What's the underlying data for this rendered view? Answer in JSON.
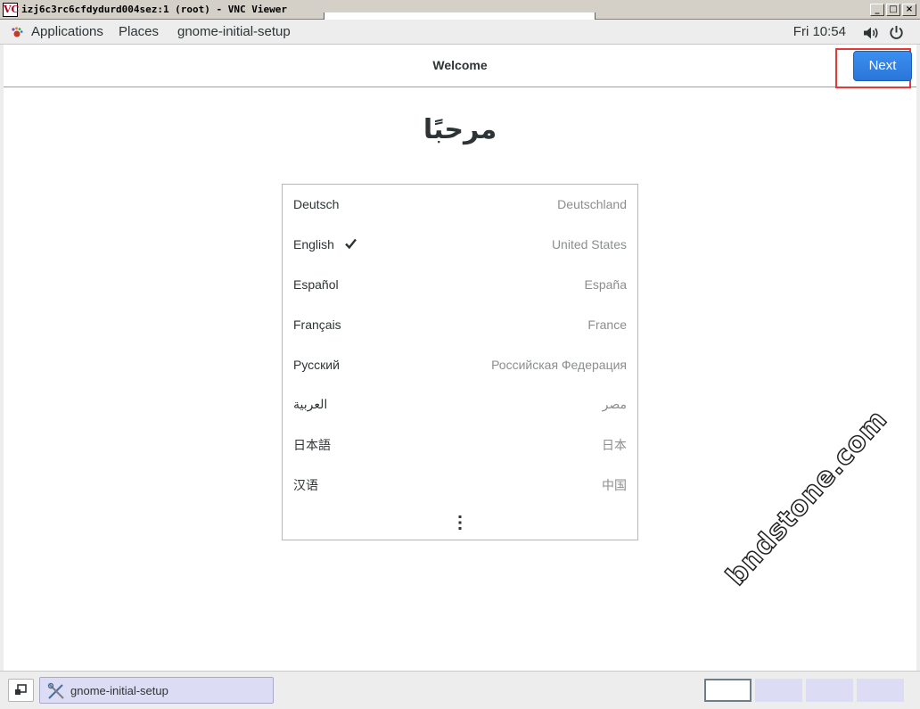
{
  "vnc_window": {
    "logo": "VC",
    "title": "izj6c3rc6cfdydurd004sez:1 (root) - VNC Viewer",
    "buttons": [
      "_",
      "□",
      "×"
    ]
  },
  "topbar": {
    "applications": "Applications",
    "places": "Places",
    "app_name": "gnome-initial-setup",
    "clock": "Fri 10:54",
    "icons": [
      "gnome-foot-icon",
      "volume-icon",
      "power-icon"
    ]
  },
  "header": {
    "title": "Welcome",
    "next_label": "Next"
  },
  "welcome_heading": "مرحبًا",
  "languages": [
    {
      "name": "Deutsch",
      "region": "Deutschland",
      "selected": false
    },
    {
      "name": "English",
      "region": "United States",
      "selected": true
    },
    {
      "name": "Español",
      "region": "España",
      "selected": false
    },
    {
      "name": "Français",
      "region": "France",
      "selected": false
    },
    {
      "name": "Русский",
      "region": "Российская Федерация",
      "selected": false
    },
    {
      "name": "العربية",
      "region": "مصر",
      "selected": false
    },
    {
      "name": "日本語",
      "region": "日本",
      "selected": false
    },
    {
      "name": "汉语",
      "region": "中国",
      "selected": false
    }
  ],
  "watermark": "bndstone.com",
  "taskbar": {
    "task_label": "gnome-initial-setup",
    "workspaces": 4,
    "active_workspace": 1
  },
  "colors": {
    "accent": "#2a76d8",
    "highlight_box": "#e53935",
    "workspace": "#dcdcf4"
  }
}
